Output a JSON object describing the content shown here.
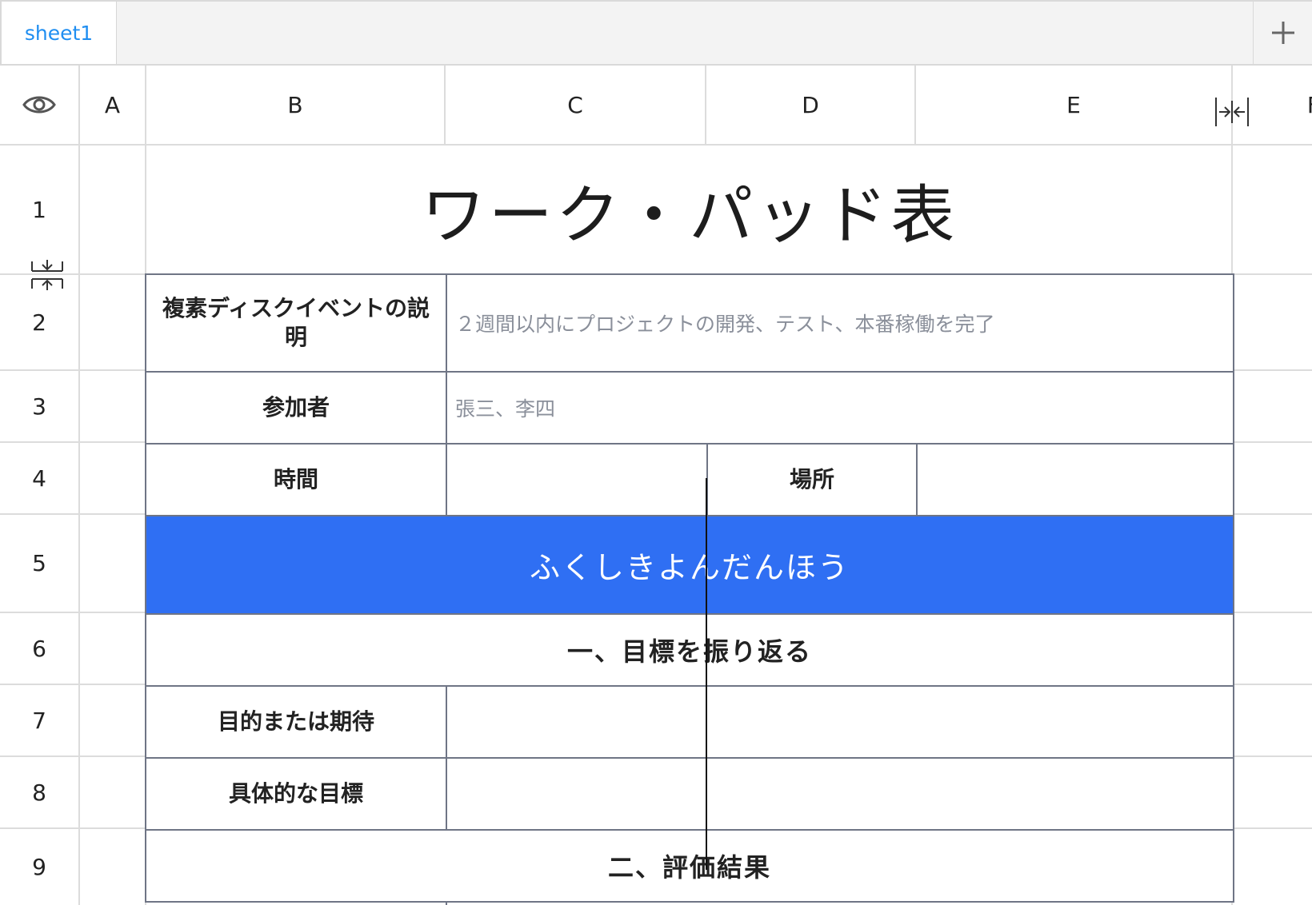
{
  "tabs": {
    "active_tab_label": "sheet1",
    "add_icon": "plus-icon"
  },
  "columns": {
    "visibility_icon": "eye-icon",
    "labels": [
      "A",
      "B",
      "C",
      "D",
      "E",
      "F"
    ],
    "collapse_icon": "column-collapse-icon"
  },
  "rows": {
    "labels": [
      "1",
      "2",
      "3",
      "4",
      "5",
      "6",
      "7",
      "8",
      "9"
    ],
    "expand_icon": "row-expand-icon"
  },
  "sheet": {
    "title": "ワーク・パッド表",
    "event_description_label": "複素ディスクイベントの説明",
    "event_description_value": "２週間以内にプロジェクトの開発、テスト、本番稼働を完了",
    "participants_label": "参加者",
    "participants_value": "張三、李四",
    "time_label": "時間",
    "time_value": "",
    "place_label": "場所",
    "place_value": "",
    "banner": "ふくしきよんだんほう",
    "section1": "一、目標を振り返る",
    "purpose_label": "目的または期待",
    "purpose_value": "",
    "specific_goal_label": "具体的な目標",
    "specific_goal_value": "",
    "section2": "二、評価結果"
  },
  "colors": {
    "accent": "#1f8ef1",
    "banner": "#2f6ff3",
    "border": "#6f7585"
  }
}
